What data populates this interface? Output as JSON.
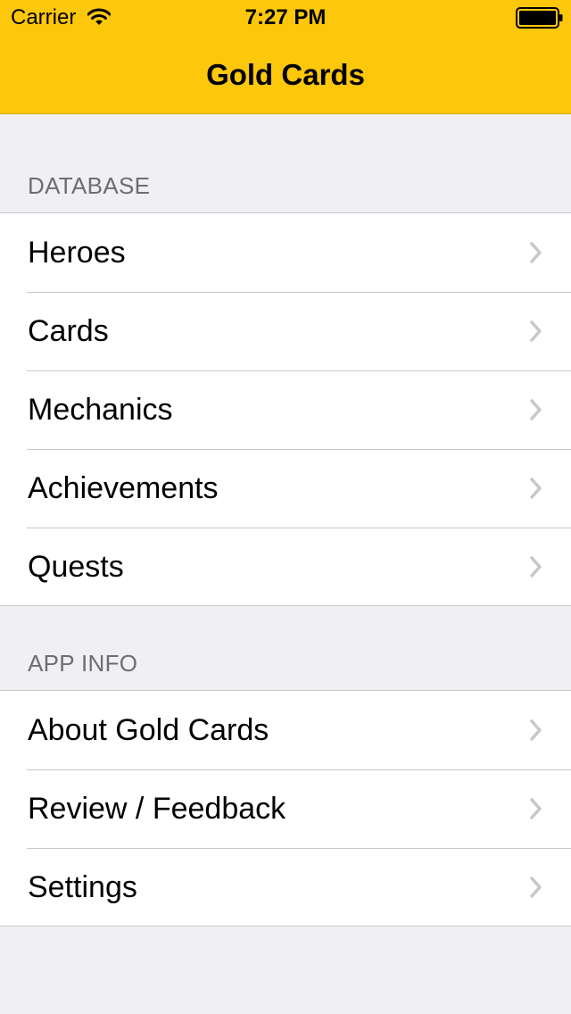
{
  "status_bar": {
    "carrier": "Carrier",
    "time": "7:27 PM"
  },
  "nav": {
    "title": "Gold Cards"
  },
  "sections": [
    {
      "header": "DATABASE",
      "items": [
        {
          "label": "Heroes"
        },
        {
          "label": "Cards"
        },
        {
          "label": "Mechanics"
        },
        {
          "label": "Achievements"
        },
        {
          "label": "Quests"
        }
      ]
    },
    {
      "header": "APP INFO",
      "items": [
        {
          "label": "About Gold Cards"
        },
        {
          "label": "Review / Feedback"
        },
        {
          "label": "Settings"
        }
      ]
    }
  ],
  "icons": {
    "wifi": "wifi-icon",
    "battery": "battery-icon",
    "chevron": "chevron-right-icon"
  },
  "colors": {
    "nav_background": "#fdc70b",
    "page_background": "#efeff4",
    "section_header_text": "#6d6d72",
    "separator": "#c8c7cc",
    "chevron": "#c7c7cc"
  }
}
